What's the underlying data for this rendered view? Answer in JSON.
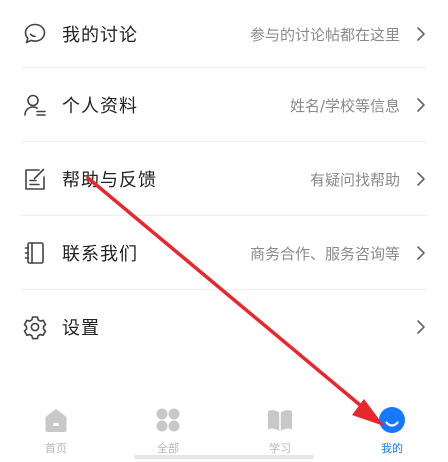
{
  "menu": {
    "items": [
      {
        "label": "我的讨论",
        "desc": "参与的讨论帖都在这里",
        "icon": "chat-bubble-icon"
      },
      {
        "label": "个人资料",
        "desc": "姓名/学校等信息",
        "icon": "person-icon"
      },
      {
        "label": "帮助与反馈",
        "desc": "有疑问找帮助",
        "icon": "edit-note-icon"
      },
      {
        "label": "联系我们",
        "desc": "商务合作、服务咨询等",
        "icon": "contact-book-icon"
      },
      {
        "label": "设置",
        "desc": "",
        "icon": "gear-icon"
      }
    ]
  },
  "tabbar": {
    "tabs": [
      {
        "label": "首页",
        "icon": "home-icon",
        "active": false
      },
      {
        "label": "全部",
        "icon": "grid-icon",
        "active": false
      },
      {
        "label": "学习",
        "icon": "book-icon",
        "active": false
      },
      {
        "label": "我的",
        "icon": "profile-icon",
        "active": true
      }
    ]
  },
  "colors": {
    "accent": "#1677ff",
    "annotation_arrow": "#e8262b",
    "inactive_tab": "#b5b5b5",
    "label": "#222222",
    "desc": "#8a8a8a"
  }
}
